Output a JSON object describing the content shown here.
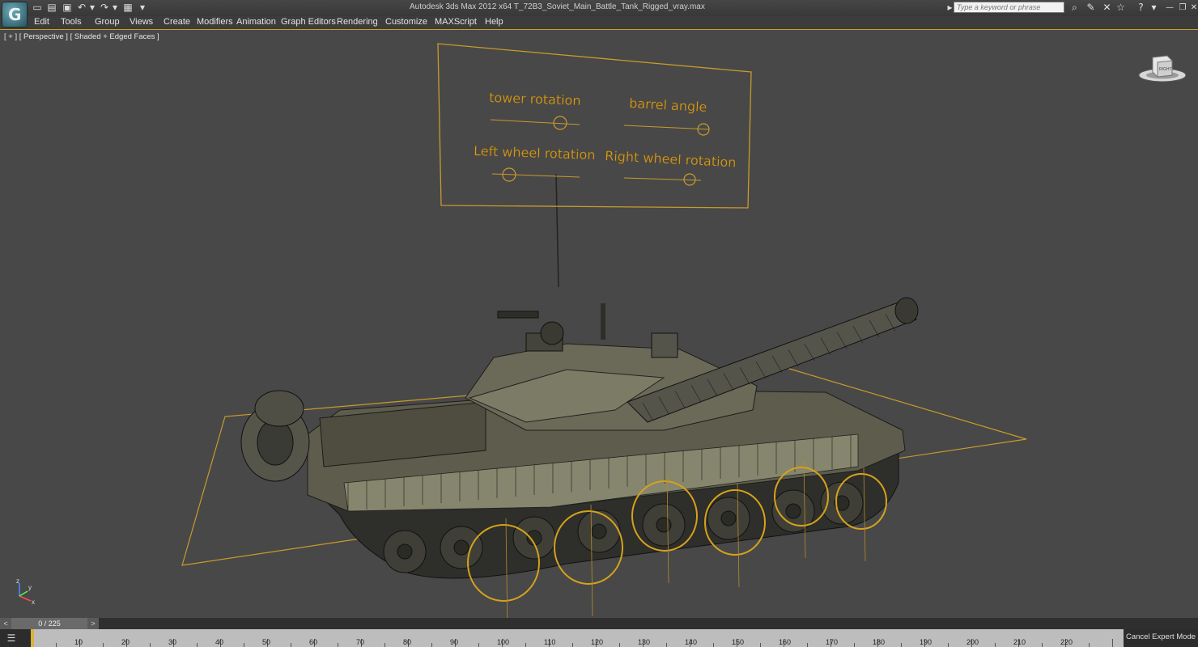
{
  "app": {
    "logo_glyph": "G",
    "title": "Autodesk 3ds Max  2012 x64     T_72B3_Soviet_Main_Battle_Tank_Rigged_vray.max",
    "search_placeholder": "Type a keyword or phrase"
  },
  "quick_access": [
    {
      "name": "new-file-icon",
      "glyph": "▭"
    },
    {
      "name": "open-file-icon",
      "glyph": "▤"
    },
    {
      "name": "save-icon",
      "glyph": "▣"
    },
    {
      "name": "undo-icon",
      "glyph": "↶"
    },
    {
      "name": "undo-dropdown-icon",
      "glyph": "▾"
    },
    {
      "name": "redo-icon",
      "glyph": "↷"
    },
    {
      "name": "redo-dropdown-icon",
      "glyph": "▾"
    },
    {
      "name": "project-folder-icon",
      "glyph": "▦"
    },
    {
      "name": "quick-access-dropdown-icon",
      "glyph": "▾"
    }
  ],
  "toolbar_right": [
    {
      "name": "search-dropdown-icon",
      "glyph": "▸"
    },
    {
      "name": "binoculars-icon",
      "glyph": "⌕"
    },
    {
      "name": "tools-icon",
      "glyph": "✎"
    },
    {
      "name": "exchange-icon",
      "glyph": "✕"
    },
    {
      "name": "favorites-star-icon",
      "glyph": "☆"
    },
    {
      "name": "help-icon",
      "glyph": "?"
    },
    {
      "name": "help-dropdown-icon",
      "glyph": "▾"
    },
    {
      "name": "minimize-icon",
      "glyph": "—"
    },
    {
      "name": "restore-icon",
      "glyph": "❐"
    },
    {
      "name": "close-icon",
      "glyph": "✕"
    }
  ],
  "menu": [
    "Edit",
    "Tools",
    "Group",
    "Views",
    "Create",
    "Modifiers",
    "Animation",
    "Graph Editors",
    "Rendering",
    "Customize",
    "MAXScript",
    "Help"
  ],
  "viewport": {
    "label": "[ + ] [ Perspective ] [ Shaded + Edged Faces ]",
    "viewcube_label": "RIGHT",
    "controls": {
      "tower": "tower rotation",
      "barrel": "barrel angle",
      "left_wheel": "Left wheel rotation",
      "right_wheel": "Right wheel rotation"
    },
    "axis": {
      "x": "x",
      "y": "y",
      "z": "z"
    }
  },
  "timeline": {
    "prev": "<",
    "next": ">",
    "frame_display": "0 / 225",
    "ticks": [
      "10",
      "20",
      "30",
      "40",
      "50",
      "60",
      "70",
      "80",
      "90",
      "100",
      "110",
      "120",
      "130",
      "140",
      "150",
      "160",
      "170",
      "180",
      "190",
      "200",
      "210",
      "220"
    ],
    "cancel_expert": "Cancel Expert Mode"
  },
  "colors": {
    "accent": "#d39b22",
    "viewport_bg": "#484848"
  }
}
